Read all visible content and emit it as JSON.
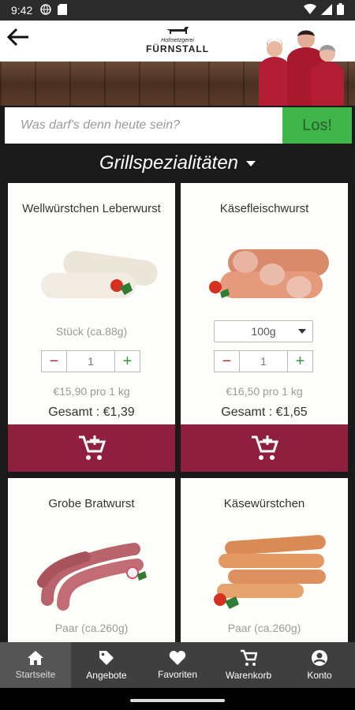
{
  "status_bar": {
    "time": "9:42"
  },
  "header": {
    "logo_small": "Hofmetzgerei",
    "logo_name": "FÜRNSTALL"
  },
  "search": {
    "placeholder": "Was darf's denn heute sein?",
    "button_label": "Los!"
  },
  "category": {
    "label": "Grillspezialitäten"
  },
  "products": [
    {
      "name": "Wellwürstchen Leberwurst",
      "unit": "Stück (ca.88g)",
      "quantity": "1",
      "price": "€15,90 pro 1 kg",
      "total": "Gesamt : €1,39"
    },
    {
      "name": "Käsefleischwurst",
      "select_value": "100g",
      "quantity": "1",
      "price": "€16,50 pro 1 kg",
      "total": "Gesamt : €1,65"
    },
    {
      "name": "Grobe Bratwurst",
      "unit": "Paar (ca.260g)"
    },
    {
      "name": "Käsewürstchen",
      "unit": "Paar (ca.260g)"
    }
  ],
  "bottom_nav": [
    {
      "label": "Startseite",
      "icon": "home-icon",
      "active": true
    },
    {
      "label": "Angebote",
      "icon": "tag-icon",
      "active": false
    },
    {
      "label": "Favoriten",
      "icon": "heart-icon",
      "active": false
    },
    {
      "label": "Warenkorb",
      "icon": "cart-icon",
      "active": false
    },
    {
      "label": "Konto",
      "icon": "account-icon",
      "active": false
    }
  ],
  "colors": {
    "accent_green": "#3fb54a",
    "cart_button": "#8f1f3e",
    "nav_bar": "#3f3f3f"
  }
}
